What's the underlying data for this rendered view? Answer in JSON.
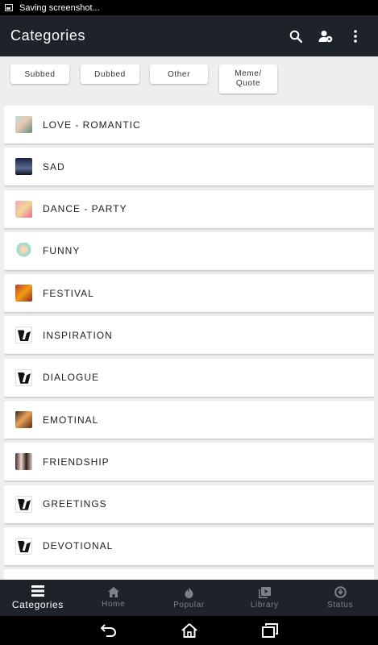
{
  "status_bar": {
    "text": "Saving screenshot..."
  },
  "app_bar": {
    "title": "Categories",
    "icons": [
      "search-icon",
      "account-settings-icon",
      "more-vert-icon"
    ]
  },
  "filters": {
    "subbed": "Subbed",
    "dubbed": "Dubbed",
    "other": "Other",
    "meme_line1": "Meme/",
    "meme_line2": "Quote"
  },
  "categories": [
    {
      "label": "LOVE - ROMANTIC",
      "thumb": "romance"
    },
    {
      "label": "SAD",
      "thumb": "sad"
    },
    {
      "label": "DANCE - PARTY",
      "thumb": "dance"
    },
    {
      "label": "FUNNY",
      "thumb": "funny"
    },
    {
      "label": "FESTIVAL",
      "thumb": "festival"
    },
    {
      "label": "INSPIRATION",
      "thumb": "mask"
    },
    {
      "label": "DIALOGUE",
      "thumb": "mask"
    },
    {
      "label": "EMOTINAL",
      "thumb": "emo"
    },
    {
      "label": "FRIENDSHIP",
      "thumb": "friend"
    },
    {
      "label": "GREETINGS",
      "thumb": "mask"
    },
    {
      "label": "DEVOTIONAL",
      "thumb": "mask"
    }
  ],
  "bottom_nav": {
    "categories": "Categories",
    "home": "Home",
    "popular": "Popular",
    "library": "Library",
    "status": "Status"
  },
  "colors": {
    "app_bar": "#1d2328",
    "background": "#eeeeee",
    "nav_inactive": "#7c8388",
    "nav_active": "#ffffff"
  }
}
